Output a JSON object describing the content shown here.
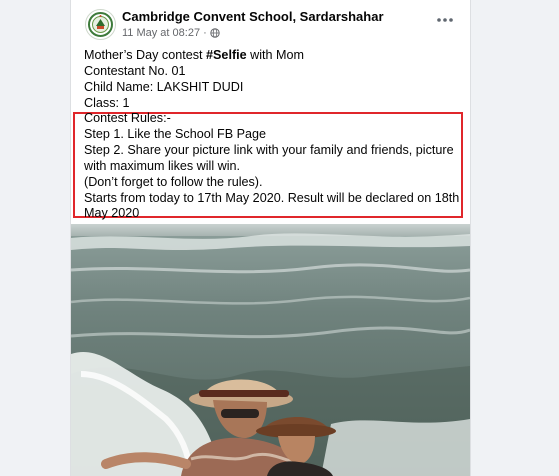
{
  "post": {
    "page_name": "Cambridge Convent School, Sardarshahar",
    "timestamp": "11 May at 08:27",
    "separator": "·",
    "visibility_icon": "globe-icon",
    "more_icon": "more-options-icon",
    "text_lines": {
      "l1_prefix": "Mother’s Day contest ",
      "l1_bold": "#Selfie",
      "l1_suffix": " with Mom",
      "l2": "Contestant No. 01",
      "l3": "Child Name:  LAKSHIT DUDI",
      "l4": "Class: 1"
    },
    "rules": {
      "heading": "Contest Rules:-",
      "step1": "Step 1. Like the School FB Page",
      "step2": "Step 2. Share your picture link with your family and friends, picture with maximum likes will win.",
      "note": "(Don’t forget to follow the rules).",
      "dates": "Starts from today to 17th May 2020. Result will be declared on 18th May 2020"
    },
    "highlight_color": "#e0262b",
    "photo_icon": "beach-selfie-photo"
  }
}
